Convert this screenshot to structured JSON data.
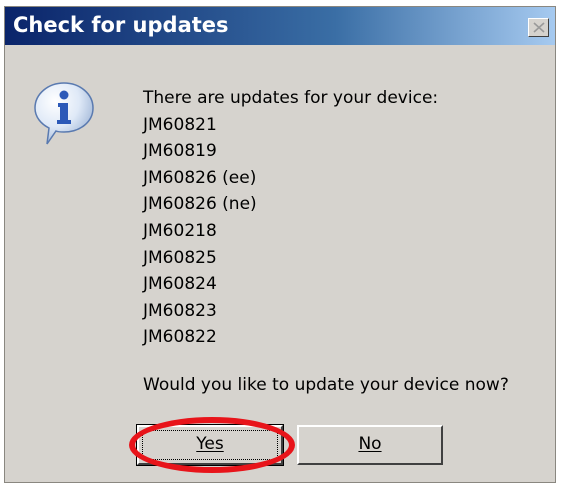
{
  "dialog": {
    "title": "Check for updates",
    "close_icon": "close-icon",
    "info_icon": "information-icon",
    "message_intro": "There are updates for your device:",
    "updates": [
      "JM60821",
      "JM60819",
      "JM60826 (ee)",
      "JM60826 (ne)",
      "JM60218",
      "JM60825",
      "JM60824",
      "JM60823",
      "JM60822"
    ],
    "question": "Would you like to update your device now?",
    "yes_label": "Yes",
    "no_label": "No"
  },
  "colors": {
    "titlebar_start": "#0a246a",
    "titlebar_end": "#a6caf0",
    "dialog_bg": "#d6d3ce",
    "highlight_ring": "#e8141a"
  }
}
